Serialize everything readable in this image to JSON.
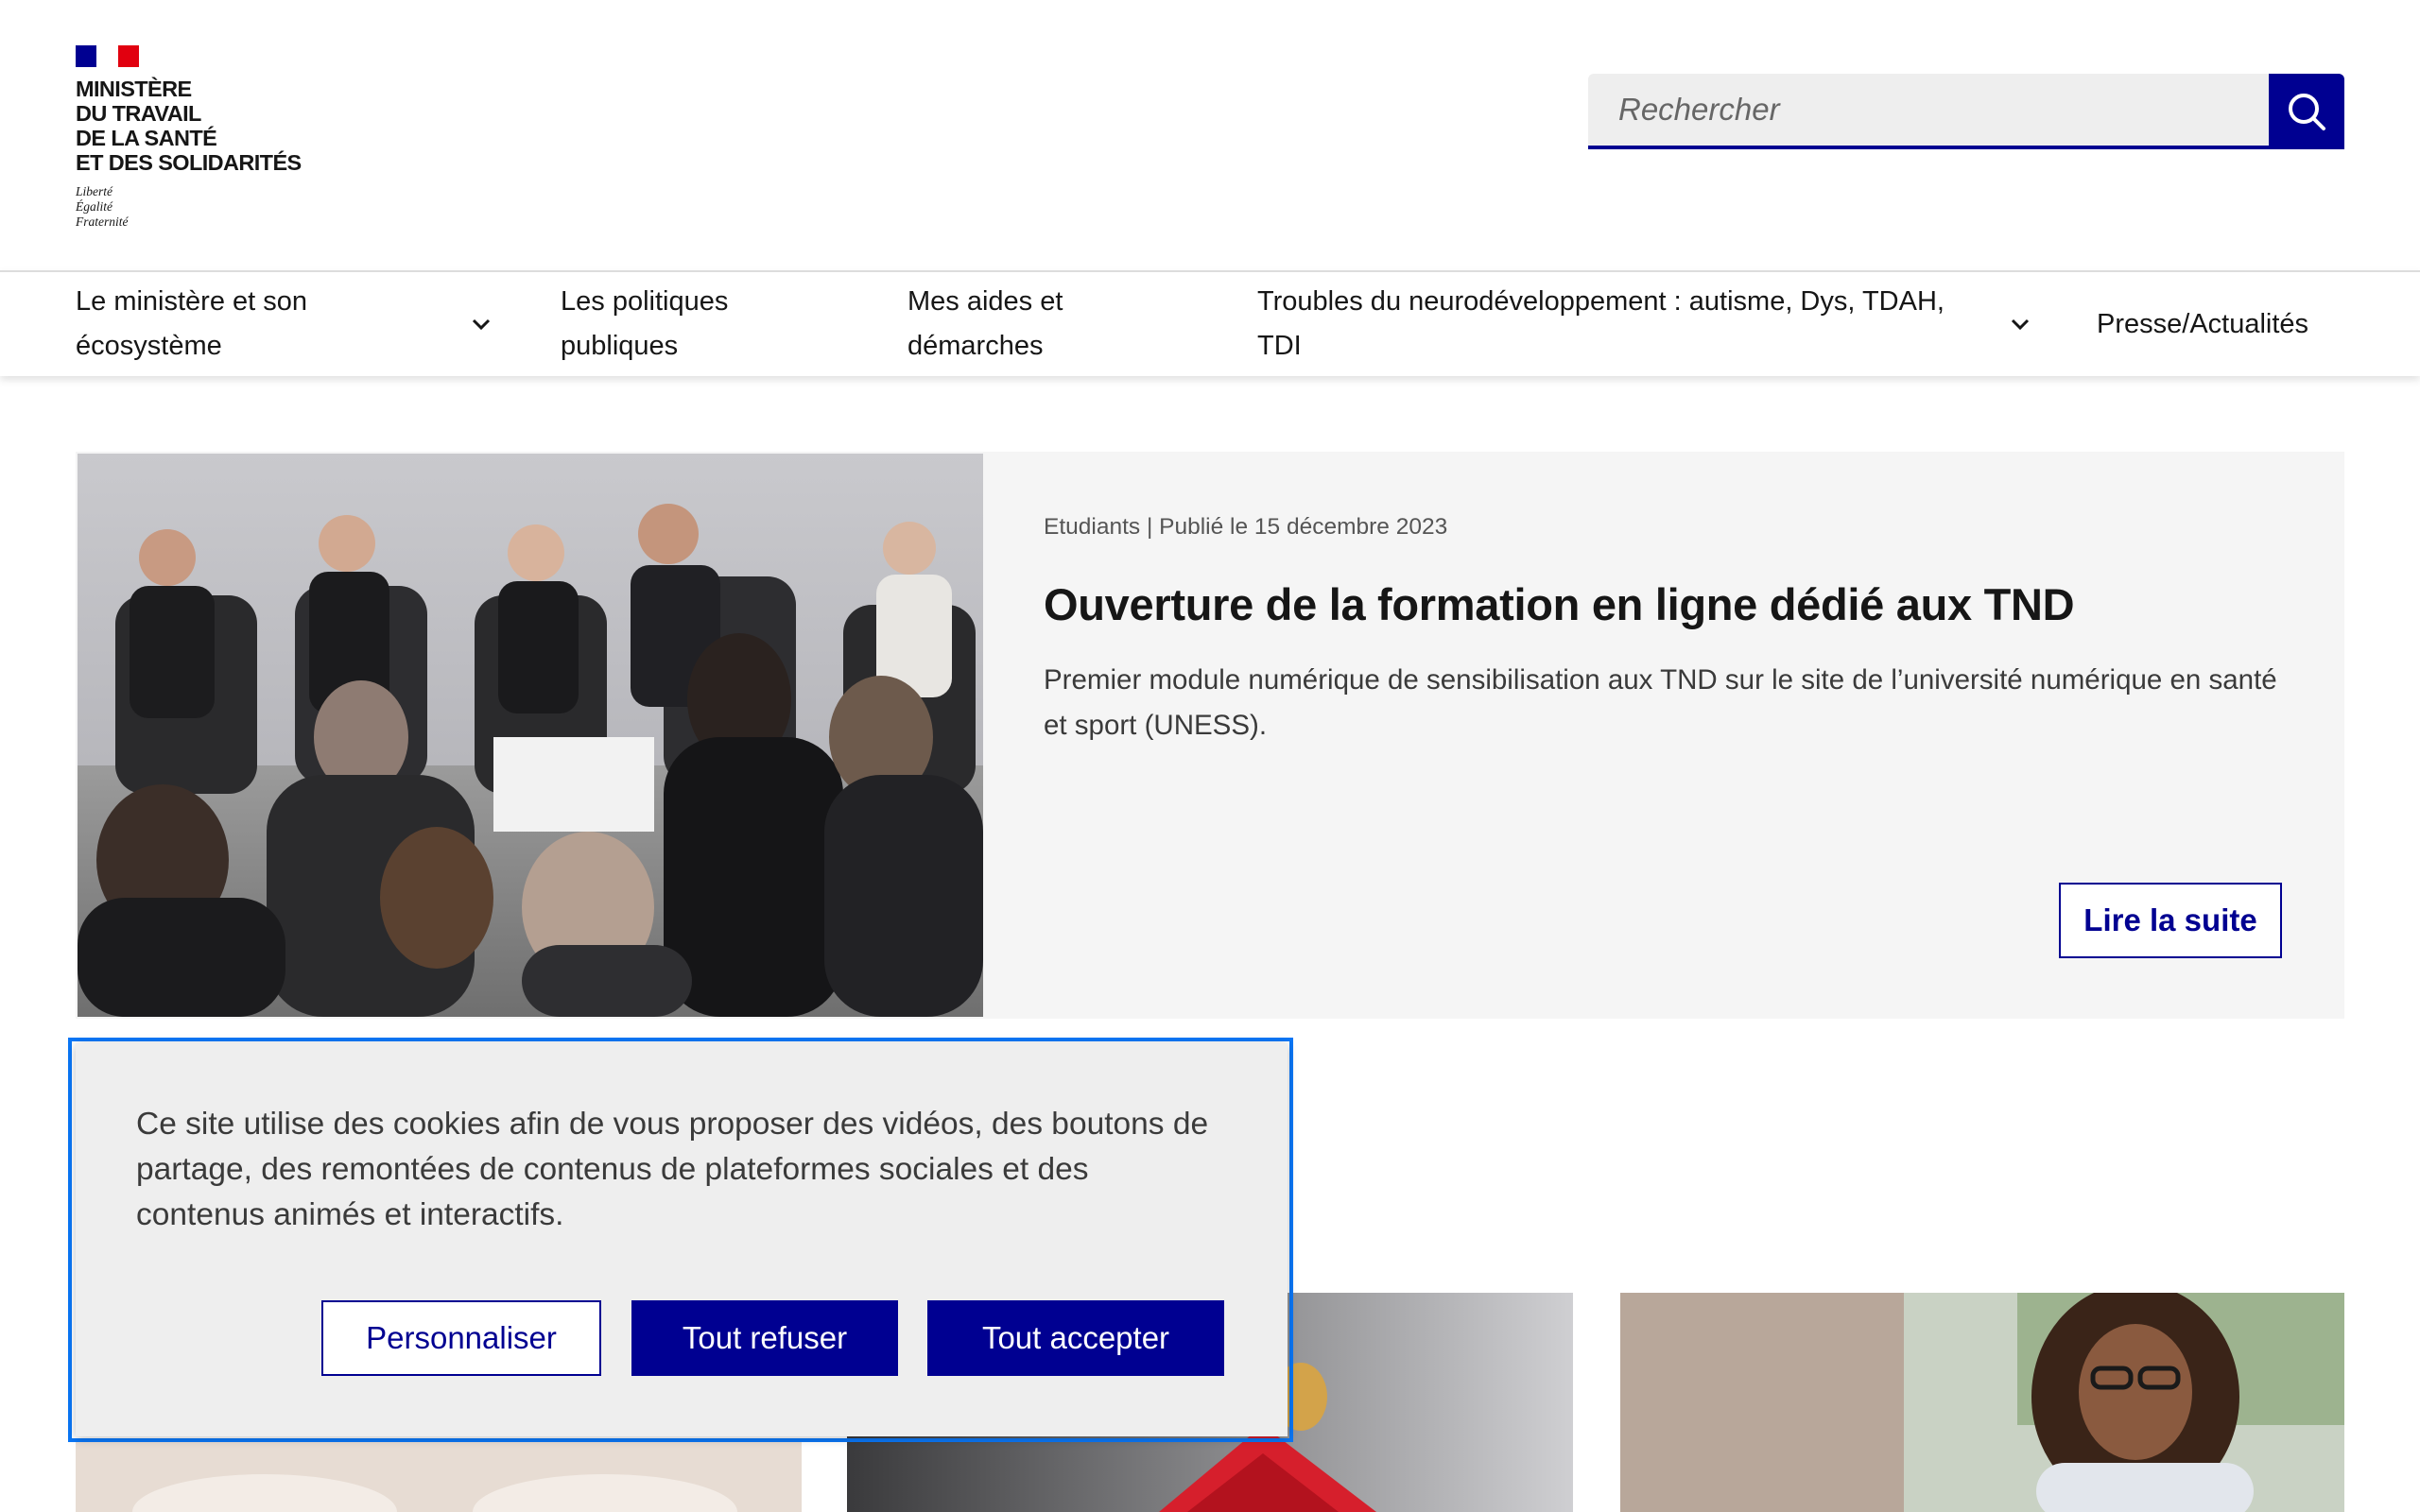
{
  "brand": {
    "ministry_lines": [
      "Ministère",
      "du Travail",
      "de la Santé",
      "et des Solidarités"
    ],
    "motto": [
      "Liberté",
      "Égalité",
      "Fraternité"
    ],
    "colors": {
      "primary": "#000091",
      "flag_red": "#e1000f",
      "focus": "#0a76f6"
    }
  },
  "search": {
    "placeholder": "Rechercher",
    "icon": "search-icon"
  },
  "nav": {
    "items": [
      {
        "label_line1": "Le ministère et son",
        "label_line2": "écosystème",
        "has_dropdown": true
      },
      {
        "label_line1": "Les politiques",
        "label_line2": "publiques",
        "has_dropdown": false
      },
      {
        "label_line1": "Mes aides et",
        "label_line2": "démarches",
        "has_dropdown": false
      },
      {
        "label_line1": "Troubles du neurodéveloppement : autisme, Dys, TDAH,",
        "label_line2": "TDI",
        "has_dropdown": true
      },
      {
        "label_line1": "Presse/Actualités",
        "label_line2": "",
        "has_dropdown": false
      }
    ]
  },
  "featured": {
    "meta": "Etudiants | Publié le 15 décembre 2023",
    "title": "Ouverture de la formation en ligne dédié aux TND",
    "description": "Premier module numérique de sensibilisation aux TND sur le site de l’université numérique en santé et sport (UNESS).",
    "cta": "Lire la suite"
  },
  "cookie": {
    "text": "Ce site utilise des cookies afin de vous proposer des vidéos, des boutons de partage, des remontées de contenus de plateformes sociales et des contenus animés et interactifs.",
    "customize": "Personnaliser",
    "refuse_all": "Tout refuser",
    "accept_all": "Tout accepter"
  }
}
